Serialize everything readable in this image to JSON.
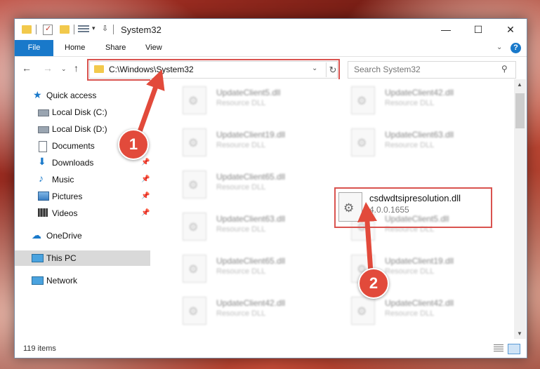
{
  "window": {
    "title": "System32",
    "minimize": "—",
    "maximize": "☐",
    "close": "✕"
  },
  "quick_access_toolbar": {
    "dropdown": "▾",
    "customize": "⇩"
  },
  "ribbon": {
    "tabs": [
      "File",
      "Home",
      "Share",
      "View"
    ],
    "expand": "⌄",
    "help": "?"
  },
  "nav": {
    "back": "←",
    "forward": "→",
    "recent": "⌄",
    "up": "↑",
    "address": "C:\\Windows\\System32",
    "address_dropdown": "⌄",
    "refresh": "↻",
    "search_placeholder": "Search System32",
    "search_icon": "⚲"
  },
  "sidebar": {
    "items": [
      {
        "label": "Quick access",
        "icon": "star-icon",
        "pinned": false
      },
      {
        "label": "Local Disk (C:)",
        "icon": "drive-icon",
        "pinned": false
      },
      {
        "label": "Local Disk (D:)",
        "icon": "drive-icon",
        "pinned": false
      },
      {
        "label": "Documents",
        "icon": "documents-icon",
        "pinned": false
      },
      {
        "label": "Downloads",
        "icon": "downloads-icon",
        "pinned": true
      },
      {
        "label": "Music",
        "icon": "music-icon",
        "pinned": true
      },
      {
        "label": "Pictures",
        "icon": "pictures-icon",
        "pinned": true
      },
      {
        "label": "Videos",
        "icon": "videos-icon",
        "pinned": true
      },
      {
        "label": "OneDrive",
        "icon": "onedrive-icon",
        "pinned": false
      },
      {
        "label": "This PC",
        "icon": "pc-icon",
        "pinned": false
      },
      {
        "label": "Network",
        "icon": "network-icon",
        "pinned": false
      }
    ],
    "pin_glyph": "📌"
  },
  "files": {
    "left_column": [
      {
        "name": "UpdateClient5.dll",
        "type": "Resource DLL"
      },
      {
        "name": "UpdateClient19.dll",
        "type": "Resource DLL"
      },
      {
        "name": "UpdateClient65.dll",
        "type": "Resource DLL"
      },
      {
        "name": "UpdateClient63.dll",
        "type": "Resource DLL"
      },
      {
        "name": "UpdateClient65.dll",
        "type": "Resource DLL"
      },
      {
        "name": "UpdateClient42.dll",
        "type": "Resource DLL"
      }
    ],
    "right_column": [
      {
        "name": "UpdateClient42.dll",
        "type": "Resource DLL"
      },
      {
        "name": "UpdateClient63.dll",
        "type": "Resource DLL"
      },
      {
        "name": "UpdateClient5.dll",
        "type": "Resource DLL"
      },
      {
        "name": "UpdateClient19.dll",
        "type": "Resource DLL"
      },
      {
        "name": "UpdateClient42.dll",
        "type": "Resource DLL"
      }
    ],
    "highlighted": {
      "name": "csdwdtsipresolution.dll",
      "version": "4.0.0.1655"
    }
  },
  "scrollbar": {
    "up": "▲",
    "down": "▼"
  },
  "status": {
    "item_count": "119 items"
  },
  "annotations": {
    "marker_1": "1",
    "marker_2": "2",
    "highlight_color": "#d9534f",
    "marker_color": "#e24a3b"
  }
}
